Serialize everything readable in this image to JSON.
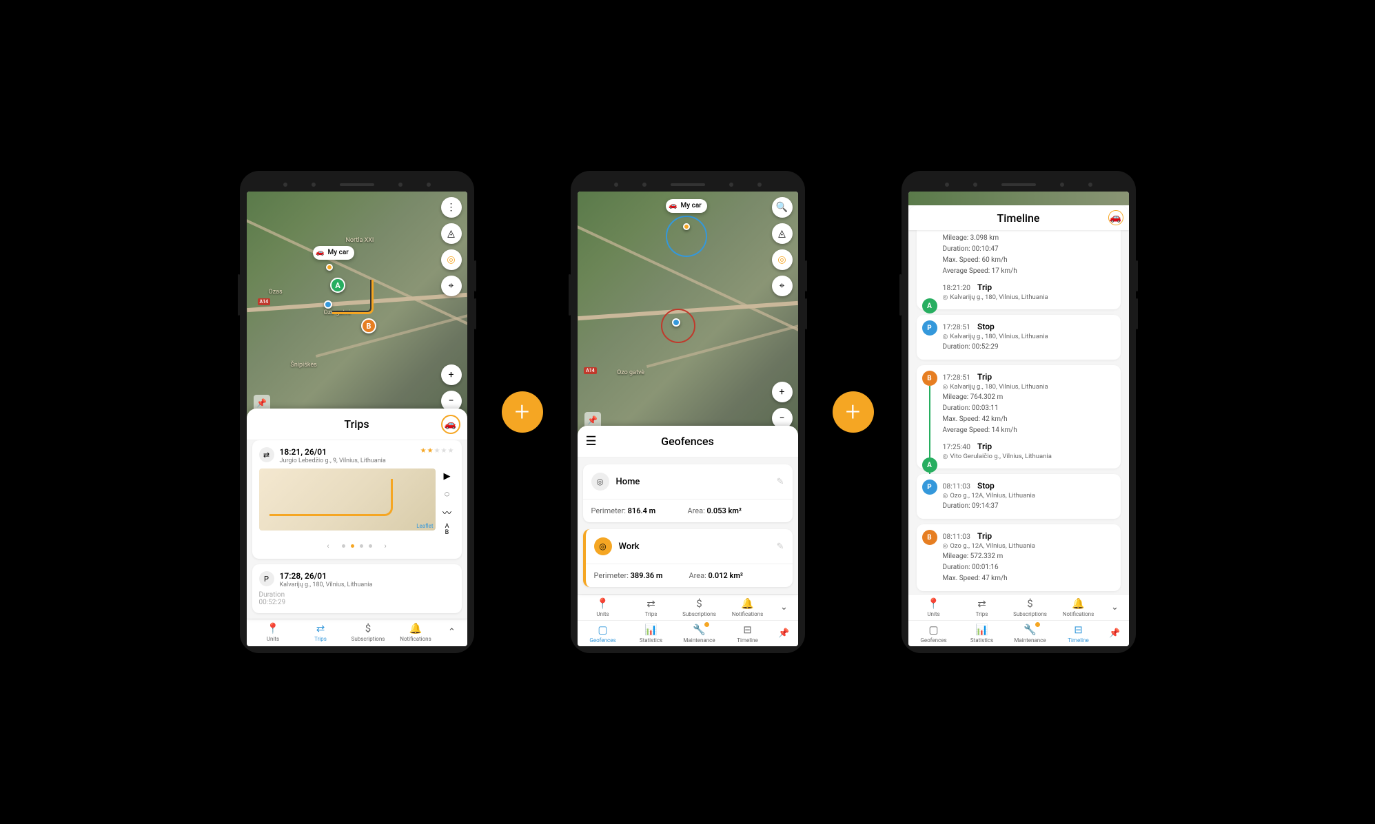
{
  "carLabel": "My car",
  "mapLabels": {
    "a": "Nortla XXI",
    "b": "Ozas",
    "c": "Ozo gatvė",
    "d": "Šnipiškės",
    "hwy": "A14"
  },
  "markers": {
    "a": "A",
    "b": "B"
  },
  "phone1": {
    "sheetTitle": "Trips",
    "trip1": {
      "time": "18:21, 26/01",
      "addr": "Jurgio Lebedžio g., 9, Vilnius, Lithuania",
      "leaflet": "Leaflet",
      "ab": "A\nB"
    },
    "trip2": {
      "time": "17:28, 26/01",
      "addr": "Kalvarijų g., 180, Vilnius, Lithuania",
      "durLabel": "Duration",
      "durVal": "00:52:29"
    },
    "nav": {
      "units": "Units",
      "trips": "Trips",
      "subs": "Subscriptions",
      "notif": "Notifications"
    }
  },
  "phone2": {
    "sheetTitle": "Geofences",
    "geo1": {
      "name": "Home",
      "perimLabel": "Perimeter: ",
      "perimVal": "816.4 m",
      "areaLabel": "Area: ",
      "areaVal": "0.053 km²"
    },
    "geo2": {
      "name": "Work",
      "perimLabel": "Perimeter: ",
      "perimVal": "389.36 m",
      "areaLabel": "Area: ",
      "areaVal": "0.012 km²"
    },
    "nav": {
      "units": "Units",
      "trips": "Trips",
      "subs": "Subscriptions",
      "notif": "Notifications",
      "geo": "Geofences",
      "stats": "Statistics",
      "maint": "Maintenance",
      "tl": "Timeline"
    }
  },
  "phone3": {
    "title": "Timeline",
    "top": {
      "mileage": "Mileage: 3.098 km",
      "duration": "Duration: 00:10:47",
      "maxSpeed": "Max. Speed: 60 km/h",
      "avgSpeed": "Average Speed: 17 km/h"
    },
    "e1": {
      "time": "18:21:20",
      "type": "Trip",
      "loc": "Kalvarijų g., 180, Vilnius, Lithuania"
    },
    "e2": {
      "time": "17:28:51",
      "type": "Stop",
      "loc": "Kalvarijų g., 180, Vilnius, Lithuania",
      "dur": "Duration: 00:52:29"
    },
    "e3": {
      "time": "17:28:51",
      "type": "Trip",
      "loc": "Kalvarijų g., 180, Vilnius, Lithuania",
      "mileage": "Mileage: 764.302 m",
      "duration": "Duration: 00:03:11",
      "maxSpeed": "Max. Speed: 42 km/h",
      "avgSpeed": "Average Speed: 14 km/h"
    },
    "e4": {
      "time": "17:25:40",
      "type": "Trip",
      "loc": "Vito Gerulaičio g., Vilnius, Lithuania"
    },
    "e5": {
      "time": "08:11:03",
      "type": "Stop",
      "loc": "Ozo g., 12A, Vilnius, Lithuania",
      "dur": "Duration: 09:14:37"
    },
    "e6": {
      "time": "08:11:03",
      "type": "Trip",
      "loc": "Ozo g., 12A, Vilnius, Lithuania",
      "mileage": "Mileage: 572.332 m",
      "duration": "Duration: 00:01:16",
      "maxSpeed": "Max. Speed: 47 km/h"
    },
    "nav": {
      "units": "Units",
      "trips": "Trips",
      "subs": "Subscriptions",
      "notif": "Notifications",
      "geo": "Geofences",
      "stats": "Statistics",
      "maint": "Maintenance",
      "tl": "Timeline"
    }
  },
  "plus": "+"
}
